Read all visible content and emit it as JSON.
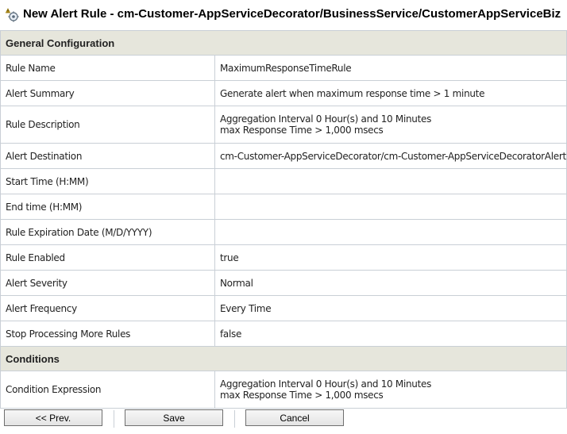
{
  "title": "New Alert Rule - cm-Customer-AppServiceDecorator/BusinessService/CustomerAppServiceBiz",
  "general": {
    "header": "General Configuration",
    "rows": [
      {
        "label": "Rule Name",
        "value": [
          "MaximumResponseTimeRule"
        ]
      },
      {
        "label": "Alert Summary",
        "value": [
          "Generate alert when maximum response time > 1 minute"
        ]
      },
      {
        "label": "Rule Description",
        "value": [
          "Aggregation Interval 0 Hour(s) and 10 Minutes",
          "max Response Time > 1,000 msecs"
        ]
      },
      {
        "label": "Alert Destination",
        "value": [
          "cm-Customer-AppServiceDecorator/cm-Customer-AppServiceDecoratorAlert"
        ]
      },
      {
        "label": "Start Time (H:MM)",
        "value": [
          ""
        ]
      },
      {
        "label": "End time (H:MM)",
        "value": [
          ""
        ]
      },
      {
        "label": "Rule Expiration Date (M/D/YYYY)",
        "value": [
          ""
        ]
      },
      {
        "label": "Rule Enabled",
        "value": [
          "true"
        ]
      },
      {
        "label": "Alert Severity",
        "value": [
          "Normal"
        ]
      },
      {
        "label": "Alert Frequency",
        "value": [
          "Every Time"
        ]
      },
      {
        "label": "Stop Processing More Rules",
        "value": [
          "false"
        ]
      }
    ]
  },
  "conditions": {
    "header": "Conditions",
    "rows": [
      {
        "label": "Condition Expression",
        "value": [
          "Aggregation Interval 0 Hour(s) and 10 Minutes",
          "max Response Time > 1,000 msecs"
        ]
      }
    ]
  },
  "buttons": {
    "prev": "<< Prev.",
    "save": "Save",
    "cancel": "Cancel"
  }
}
